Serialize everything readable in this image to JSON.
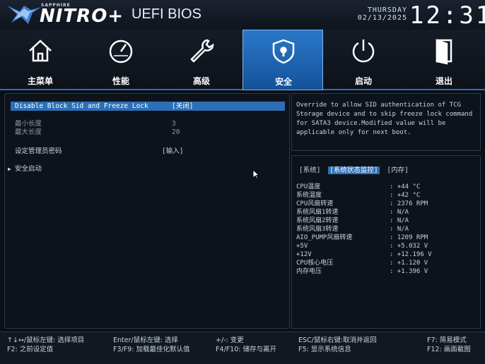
{
  "brand": {
    "small": "SAPPHIRE",
    "main": "NITRO+",
    "bios_title": "UEFI BIOS"
  },
  "datetime": {
    "weekday": "THURSDAY",
    "date": "02/13/2025",
    "clock": "12:31"
  },
  "tabs": [
    {
      "label": "主菜单",
      "icon": "home-icon",
      "active": false
    },
    {
      "label": "性能",
      "icon": "speedometer-icon",
      "active": false
    },
    {
      "label": "高级",
      "icon": "wrench-icon",
      "active": false
    },
    {
      "label": "安全",
      "icon": "shield-lock-icon",
      "active": true
    },
    {
      "label": "启动",
      "icon": "power-icon",
      "active": false
    },
    {
      "label": "退出",
      "icon": "exit-door-icon",
      "active": false
    }
  ],
  "settings": {
    "sid_lock": {
      "name": "Disable Block Sid and Freeze Lock",
      "value": "[关闭]"
    },
    "min_length": {
      "name": "最小长度",
      "value": "3"
    },
    "max_length": {
      "name": "最大长度",
      "value": "20"
    },
    "admin_password": {
      "name": "设定管理员密码",
      "value": "[输入]"
    },
    "secure_boot": {
      "name": "安全启动"
    }
  },
  "help_text": "Override to allow SID authentication of TCG Storage device and to skip freeze lock command for SATA3 device.Modified value will be applicable only for next boot.",
  "monitor": {
    "tabs": [
      "[系统]",
      "[系统状态监控]",
      "[内存]"
    ],
    "rows": [
      {
        "k": "CPU温度",
        "v": ": +44 °C"
      },
      {
        "k": "系统温度",
        "v": ": +42 °C"
      },
      {
        "k": "CPU风扇转速",
        "v": ": 2376 RPM"
      },
      {
        "k": "系统风扇1转速",
        "v": ": N/A"
      },
      {
        "k": "系统风扇2转速",
        "v": ": N/A"
      },
      {
        "k": "系统风扇3转速",
        "v": ": N/A"
      },
      {
        "k": "AIO_PUMP风扇转速",
        "v": ": 1209 RPM"
      },
      {
        "k": "+5V",
        "v": ": +5.032 V"
      },
      {
        "k": "+12V",
        "v": ": +12.196 V"
      },
      {
        "k": "CPU核心电压",
        "v": ": +1.120 V"
      },
      {
        "k": "内存电压",
        "v": ": +1.396 V"
      }
    ]
  },
  "footer": {
    "k1a": "↑↓↔/鼠标左键: 选择项目",
    "k1b": "F2: 之前设定值",
    "k2a": "Enter/鼠标左键: 选择",
    "k2b": "F3/F9: 加载最佳化默认值",
    "k3a": "+/-: 变更",
    "k3b": "F4/F10: 储存与离开",
    "k4a": "ESC/鼠标右键:取消并返回",
    "k4b": "F5: 显示系统信息",
    "k5a": "F7: 简易模式",
    "k5b": "F12: 画面截图"
  },
  "colors": {
    "accent": "#2d6fb6",
    "tab_active": "#1f65b0",
    "background": "#0b0f16"
  }
}
